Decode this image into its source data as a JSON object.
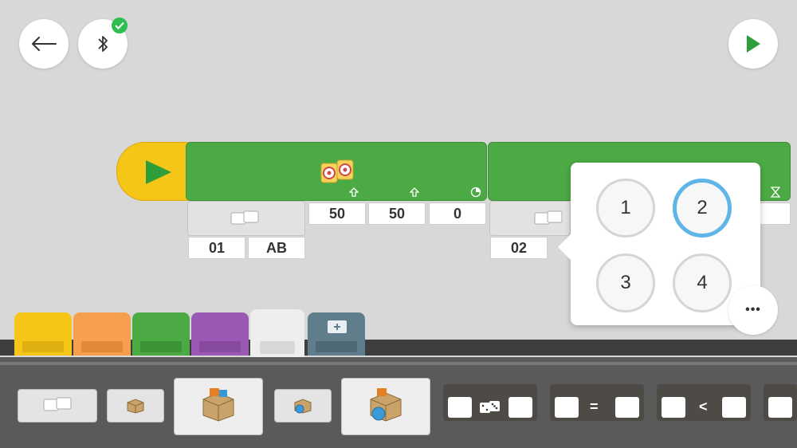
{
  "header": {
    "back_icon": "arrow-left-icon",
    "bluetooth_icon": "bluetooth-icon",
    "bluetooth_status_icon": "check-badge-icon",
    "play_icon": "play-icon"
  },
  "program": {
    "start_icon": "play-icon",
    "motor_block": {
      "port_values": [
        "01",
        "AB"
      ],
      "params": [
        "50",
        "50",
        "0"
      ]
    },
    "second_block": {
      "port_value": "02"
    }
  },
  "port_picker": {
    "options": [
      "1",
      "2",
      "3",
      "4"
    ],
    "selected": "2"
  },
  "more_label": "•••",
  "categories": [
    {
      "name": "yellow",
      "color": "#f5c518"
    },
    {
      "name": "orange",
      "color": "#f6a04d"
    },
    {
      "name": "green",
      "color": "#4caa45"
    },
    {
      "name": "purple",
      "color": "#9b59b6"
    },
    {
      "name": "white",
      "color": "#eeeeee"
    },
    {
      "name": "my-blocks",
      "color": "#607d8b"
    }
  ],
  "palette": {
    "operators": [
      "=",
      "<"
    ]
  },
  "colors": {
    "accent_blue": "#5fb6e6",
    "block_green": "#4caa45",
    "start_yellow": "#f5c518",
    "play_green": "#2e9e3a"
  }
}
